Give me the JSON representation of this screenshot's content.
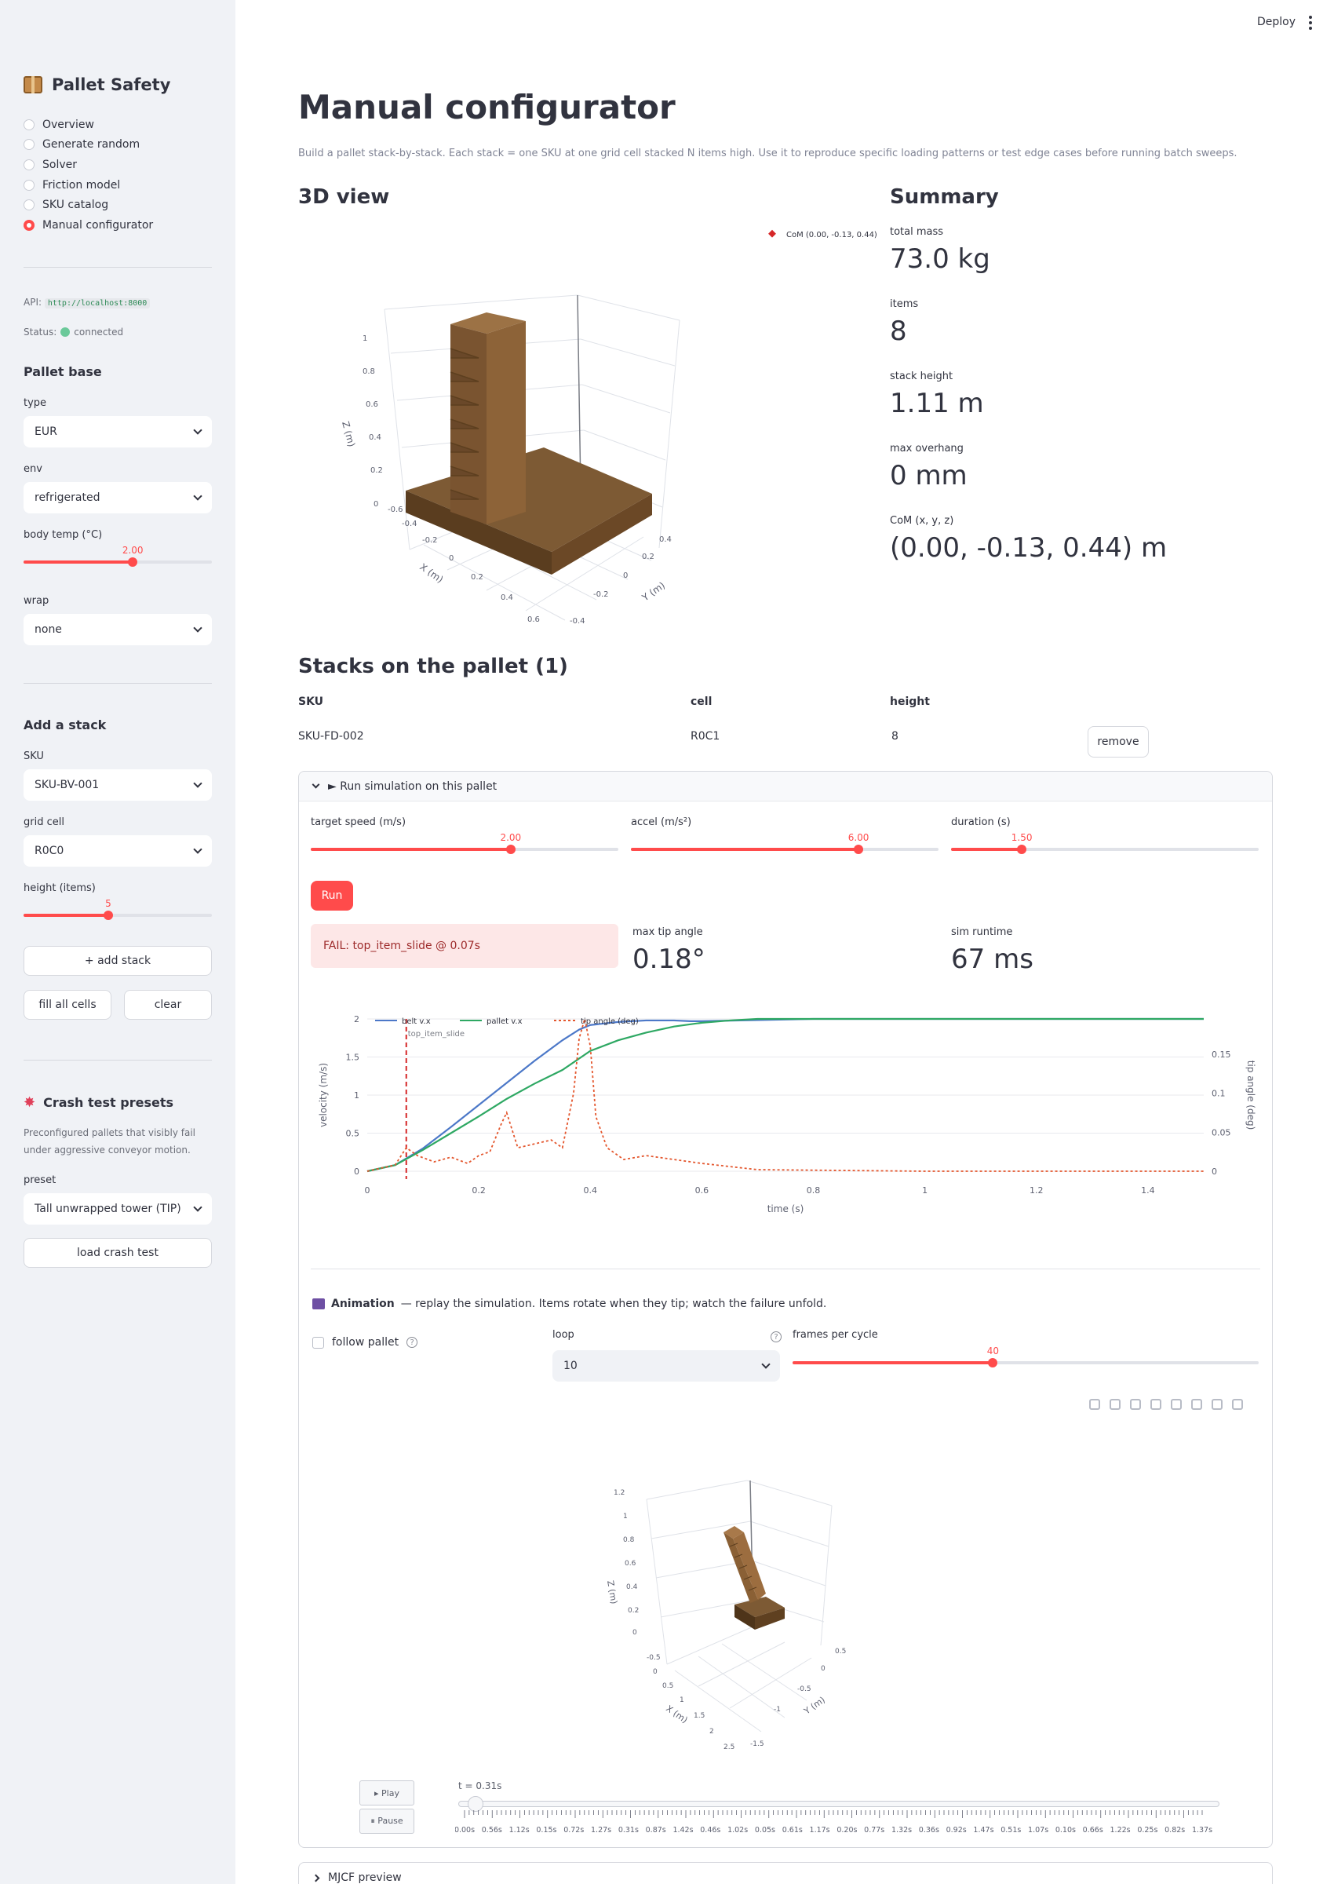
{
  "sidebar": {
    "title": "Pallet Safety",
    "nav": [
      {
        "label": "Overview",
        "selected": false
      },
      {
        "label": "Generate random",
        "selected": false
      },
      {
        "label": "Solver",
        "selected": false
      },
      {
        "label": "Friction model",
        "selected": false
      },
      {
        "label": "SKU catalog",
        "selected": false
      },
      {
        "label": "Manual configurator",
        "selected": true
      }
    ],
    "api_label": "API:",
    "api_value": "http://localhost:8000",
    "status_label": "Status:",
    "status_value": "connected",
    "pallet_base": {
      "heading": "Pallet base",
      "type_label": "type",
      "type_value": "EUR",
      "env_label": "env",
      "env_value": "refrigerated",
      "temp_label": "body temp (°C)",
      "temp_value": "2.00",
      "temp_fraction": 0.58,
      "wrap_label": "wrap",
      "wrap_value": "none"
    },
    "add_stack": {
      "heading": "Add a stack",
      "sku_label": "SKU",
      "sku_value": "SKU-BV-001",
      "cell_label": "grid cell",
      "cell_value": "R0C0",
      "height_label": "height (items)",
      "height_value": "5",
      "height_fraction": 0.45,
      "add_label": "+ add stack",
      "fill_label": "fill all cells",
      "clear_label": "clear"
    },
    "crash": {
      "heading": "Crash test presets",
      "description": "Preconfigured pallets that visibly fail under aggressive conveyor motion.",
      "preset_label": "preset",
      "preset_value": "Tall unwrapped tower (TIP)",
      "load_label": "load crash test"
    }
  },
  "header": {
    "deploy_label": "Deploy"
  },
  "main": {
    "title": "Manual configurator",
    "caption": "Build a pallet stack-by-stack. Each stack = one SKU at one grid cell stacked N items high. Use it to reproduce specific loading patterns or test edge cases before running batch sweeps.",
    "view_heading": "3D view",
    "com_legend": "CoM (0.00, -0.13, 0.44)",
    "summary_heading": "Summary",
    "metrics": [
      {
        "label": "total mass",
        "value": "73.0 kg"
      },
      {
        "label": "items",
        "value": "8"
      },
      {
        "label": "stack height",
        "value": "1.11 m"
      },
      {
        "label": "max overhang",
        "value": "0 mm"
      },
      {
        "label": "CoM (x, y, z)",
        "value": "(0.00, -0.13, 0.44) m"
      }
    ],
    "stacks_heading": "Stacks on the pallet (1)",
    "stacks_columns": [
      "SKU",
      "cell",
      "height"
    ],
    "stacks_rows": [
      {
        "sku": "SKU-FD-002",
        "cell": "R0C1",
        "height": "8",
        "remove_label": "remove"
      }
    ],
    "plot3d": {
      "x_label": "X (m)",
      "y_label": "Y (m)",
      "z_label": "Z (m)",
      "z_ticks": [
        "0",
        "0.2",
        "0.4",
        "0.6",
        "0.8",
        "1"
      ],
      "x_ticks": [
        "-0.6",
        "-0.4",
        "-0.2",
        "0",
        "0.2",
        "0.4",
        "0.6"
      ],
      "y_ticks": [
        "0.4",
        "0.2",
        "0",
        "-0.2",
        "-0.4"
      ]
    }
  },
  "simulation": {
    "expander_label": "► Run simulation on this pallet",
    "speed_label": "target speed (m/s)",
    "speed_value": "2.00",
    "speed_fraction": 0.65,
    "accel_label": "accel (m/s²)",
    "accel_value": "6.00",
    "accel_fraction": 0.74,
    "duration_label": "duration (s)",
    "duration_value": "1.50",
    "duration_fraction": 0.23,
    "run_label": "Run",
    "fail_text": "FAIL: top_item_slide @ 0.07s",
    "max_tip_label": "max tip angle",
    "max_tip_value": "0.18°",
    "runtime_label": "sim runtime",
    "runtime_value": "67 ms",
    "chart_data": {
      "type": "line",
      "xlabel": "time (s)",
      "ylabel": "velocity (m/s)",
      "y2label": "tip angle (deg)",
      "xlim": [
        0,
        1.5
      ],
      "ylim": [
        0,
        2
      ],
      "y2lim": [
        0,
        0.195
      ],
      "x_ticks": [
        0,
        0.2,
        0.4,
        0.6,
        0.8,
        1,
        1.2,
        1.4
      ],
      "y_ticks": [
        0,
        0.5,
        1,
        1.5,
        2
      ],
      "y2_ticks": [
        0,
        0.05,
        0.1,
        0.15
      ],
      "annotation": {
        "x": 0.07,
        "label": "top_item_slide"
      },
      "series": [
        {
          "name": "belt v.x",
          "color": "#4c78c8",
          "axis": "y",
          "x": [
            0,
            0.05,
            0.1,
            0.15,
            0.2,
            0.25,
            0.3,
            0.35,
            0.38,
            0.4,
            0.45,
            0.5,
            0.55,
            0.58,
            0.6,
            0.8,
            1.0,
            1.2,
            1.5
          ],
          "y": [
            0,
            0.08,
            0.3,
            0.58,
            0.87,
            1.16,
            1.45,
            1.72,
            1.86,
            1.92,
            1.96,
            1.98,
            1.98,
            1.97,
            1.97,
            2.0,
            2.0,
            2.0,
            2.0
          ]
        },
        {
          "name": "pallet v.x",
          "color": "#2ea863",
          "axis": "y",
          "x": [
            0,
            0.05,
            0.1,
            0.15,
            0.2,
            0.25,
            0.3,
            0.35,
            0.4,
            0.45,
            0.5,
            0.55,
            0.6,
            0.65,
            0.7,
            0.8,
            1.0,
            1.2,
            1.5
          ],
          "y": [
            0,
            0.08,
            0.28,
            0.5,
            0.72,
            0.95,
            1.15,
            1.33,
            1.58,
            1.72,
            1.82,
            1.9,
            1.95,
            1.98,
            2.0,
            2.0,
            2.0,
            2.0,
            2.0
          ]
        },
        {
          "name": "tip angle (deg)",
          "color": "#e4572e",
          "axis": "y2",
          "dash": true,
          "x": [
            0,
            0.05,
            0.07,
            0.09,
            0.12,
            0.15,
            0.18,
            0.2,
            0.22,
            0.24,
            0.25,
            0.27,
            0.3,
            0.33,
            0.35,
            0.37,
            0.38,
            0.39,
            0.4,
            0.41,
            0.43,
            0.46,
            0.5,
            0.55,
            0.6,
            0.7,
            1.0,
            1.5
          ],
          "y": [
            0,
            0.008,
            0.03,
            0.02,
            0.012,
            0.018,
            0.01,
            0.02,
            0.025,
            0.06,
            0.075,
            0.03,
            0.035,
            0.04,
            0.03,
            0.1,
            0.17,
            0.195,
            0.16,
            0.07,
            0.03,
            0.015,
            0.02,
            0.015,
            0.01,
            0.002,
            0,
            0
          ]
        }
      ]
    },
    "animation": {
      "title": "Animation",
      "description": "— replay the simulation. Items rotate when they tip; watch the failure unfold.",
      "follow_label": "follow pallet",
      "loop_label": "loop",
      "loop_value": "10",
      "frames_label": "frames per cycle",
      "frames_value": "40",
      "frames_fraction": 0.43,
      "play_label": "▸ Play",
      "pause_label": "⏸ Pause",
      "time_label": "t = 0.31s",
      "time_ticks": [
        "0.00s",
        "0.56s",
        "1.12s",
        "0.15s",
        "0.72s",
        "1.27s",
        "0.31s",
        "0.87s",
        "1.42s",
        "0.46s",
        "1.02s",
        "0.05s",
        "0.61s",
        "1.17s",
        "0.20s",
        "0.77s",
        "1.32s",
        "0.36s",
        "0.92s",
        "1.47s",
        "0.51s",
        "1.07s",
        "0.10s",
        "0.66s",
        "1.22s",
        "0.25s",
        "0.82s",
        "1.37s"
      ],
      "z_ticks": [
        "0",
        "0.2",
        "0.4",
        "0.6",
        "0.8",
        "1",
        "1.2"
      ],
      "x_ticks": [
        "-0.5",
        "0",
        "0.5",
        "1",
        "1.5",
        "2",
        "2.5"
      ],
      "y_ticks": [
        "0.5",
        "0",
        "-0.5",
        "-1",
        "-1.5"
      ],
      "x_label": "X (m)",
      "y_label": "Y (m)",
      "z_label": "Z (m)"
    },
    "mjcf_label": "MJCF preview"
  }
}
